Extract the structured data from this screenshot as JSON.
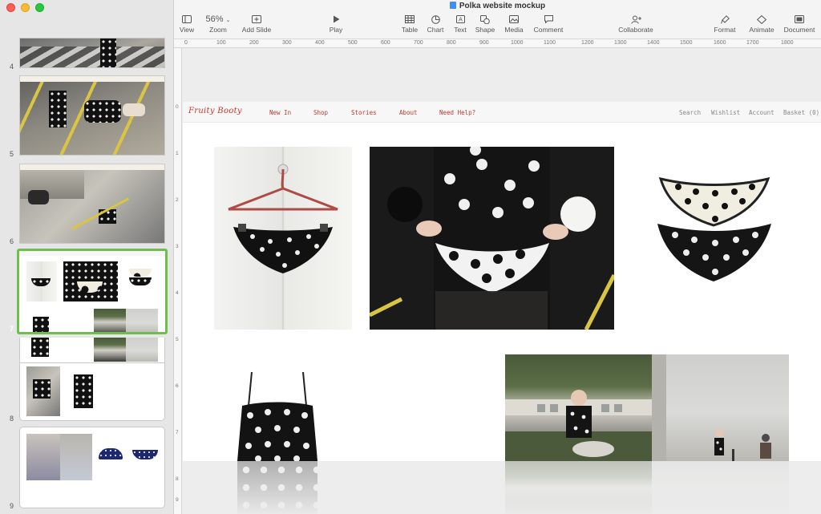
{
  "window": {
    "title": "Polka website mockup"
  },
  "toolbar": {
    "view": "View",
    "zoom_value": "56%",
    "zoom": "Zoom",
    "add_slide": "Add Slide",
    "play": "Play",
    "table": "Table",
    "chart": "Chart",
    "text": "Text",
    "shape": "Shape",
    "media": "Media",
    "comment": "Comment",
    "collaborate": "Collaborate",
    "format": "Format",
    "animate": "Animate",
    "document": "Document"
  },
  "ruler": {
    "top": [
      "0",
      "100",
      "200",
      "300",
      "400",
      "500",
      "600",
      "700",
      "800",
      "900",
      "1000",
      "1100",
      "1200",
      "1300",
      "1400",
      "1500",
      "1600",
      "1700",
      "1800"
    ],
    "left": [
      "0",
      "1",
      "2",
      "3",
      "4",
      "5",
      "6",
      "7",
      "8",
      "9"
    ]
  },
  "slides": [
    {
      "number": "4"
    },
    {
      "number": "5"
    },
    {
      "number": "6"
    },
    {
      "number": "7",
      "selected": true
    },
    {
      "number": "8"
    },
    {
      "number": "9"
    }
  ],
  "site": {
    "logo": "Fruity Booty",
    "nav_left": [
      "New In",
      "Shop",
      "Stories",
      "About",
      "Need Help?"
    ],
    "nav_right": [
      "Search",
      "Wishlist",
      "Account",
      "Basket (0)"
    ]
  },
  "colors": {
    "accent_green": "#6cc04a",
    "nav_red": "#c0392b"
  }
}
